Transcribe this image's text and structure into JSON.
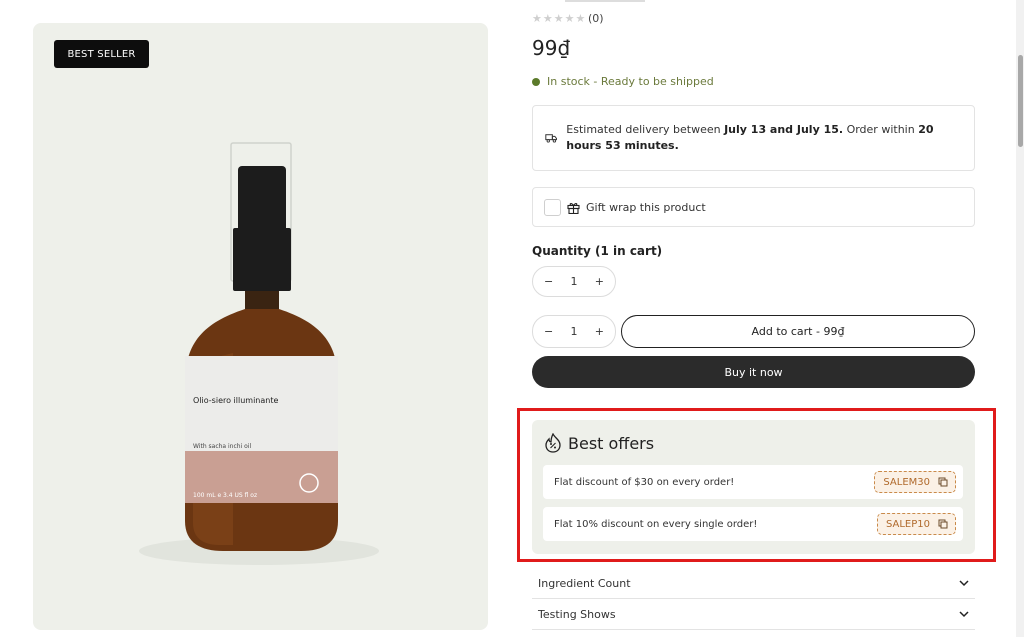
{
  "badge": "BEST SELLER",
  "product": {
    "label_title": "Olio-siero illuminante",
    "label_sub": "With sacha inchi oil",
    "label_footer": "100 mL e 3.4 US fl oz"
  },
  "rating": {
    "stars": "★★★★★",
    "count": "(0)"
  },
  "price": "99₫",
  "stock": "In stock - Ready to be shipped",
  "delivery": {
    "prefix": "Estimated delivery between ",
    "dates": "July 13 and July 15.",
    "mid": " Order within ",
    "time": "20 hours 53 minutes."
  },
  "gift_wrap": "Gift wrap this product",
  "quantity": {
    "label": "Quantity (1 in cart)",
    "value": "1",
    "minus": "−",
    "plus": "+"
  },
  "add_to_cart": "Add to cart - 99₫",
  "buy_now": "Buy it now",
  "offers": {
    "title": "Best offers",
    "items": [
      {
        "text": "Flat discount of $30 on every order!",
        "code": "SALEM30"
      },
      {
        "text": "Flat 10% discount on every single order!",
        "code": "SALEP10"
      }
    ]
  },
  "accordion": [
    {
      "label": "Ingredient Count"
    },
    {
      "label": "Testing Shows"
    }
  ],
  "colors": {
    "offers_bg": "#eef0ea",
    "coupon_border": "#c98a4a",
    "highlight": "#e01b1b",
    "stock_green": "#5b7a2a"
  }
}
